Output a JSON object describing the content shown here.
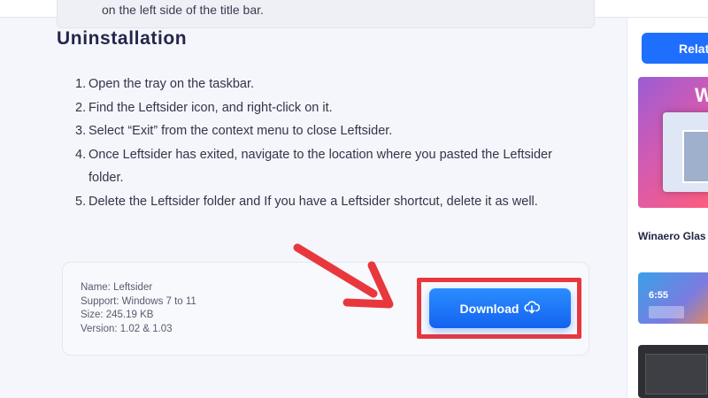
{
  "previous_section": {
    "partial_text": "on the left side of the title bar."
  },
  "uninstallation": {
    "title": "Uninstallation",
    "steps": [
      {
        "num": "1.",
        "text": "Open the tray on the taskbar."
      },
      {
        "num": "2.",
        "text": "Find the Leftsider icon, and right-click on it."
      },
      {
        "num": "3.",
        "text": "Select “Exit” from the context menu to close Leftsider."
      },
      {
        "num": "4.",
        "text": "Once Leftsider has exited, navigate to the location where you pasted the Leftsider folder."
      },
      {
        "num": "5.",
        "text": "Delete the Leftsider folder and If you have a Leftsider shortcut, delete it as well."
      }
    ]
  },
  "download_card": {
    "name": "Name: Leftsider",
    "support": "Support: Windows 7 to 11",
    "size": "Size: 245.19 KB",
    "version": "Version: 1.02 & 1.03",
    "button_label": "Download",
    "button_icon": "cloud-download-icon",
    "highlight_color": "#e8383d",
    "button_color": "#1463f0"
  },
  "sidebar": {
    "related_label": "Relat",
    "thumb1_letter": "W",
    "thumb1_caption": "Winaero Glas",
    "thumb2_clock": "6:55"
  }
}
